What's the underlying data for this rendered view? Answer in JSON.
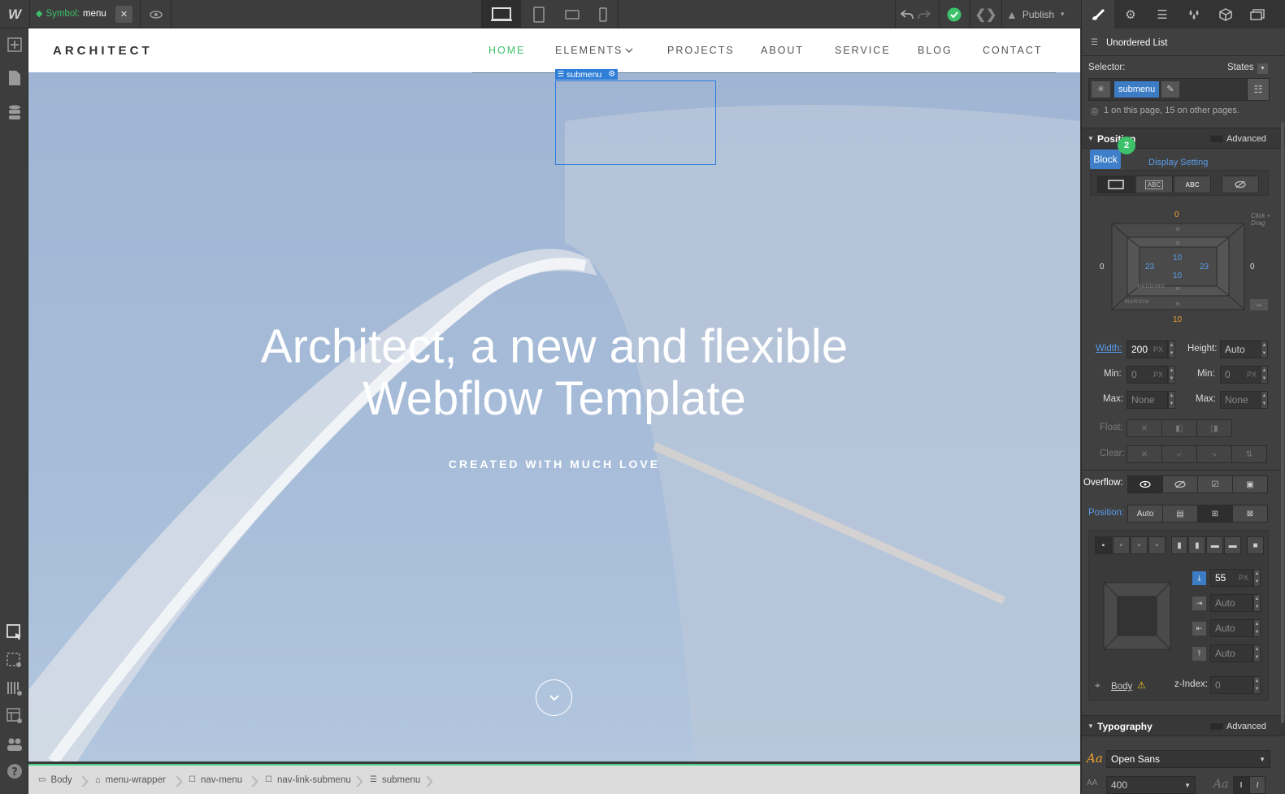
{
  "topbar": {
    "logo": "W",
    "symbol_prefix": "Symbol:",
    "symbol_name": "menu",
    "close_glyph": "✕",
    "publish_label": "Publish"
  },
  "canvas": {
    "brand": "ARCHITECT",
    "nav": [
      "HOME",
      "ELEMENTS",
      "PROJECTS",
      "ABOUT",
      "SERVICE",
      "BLOG",
      "CONTACT"
    ],
    "active_nav": "HOME",
    "selection_label": "submenu",
    "hero_title_line1": "Architect, a new and flexible",
    "hero_title_line2": "Webflow Template",
    "hero_subtitle": "CREATED WITH MUCH LOVE"
  },
  "breadcrumbs": [
    "Body",
    "menu-wrapper",
    "nav-menu",
    "nav-link-submenu",
    "submenu"
  ],
  "panel": {
    "element_type": "Unordered List",
    "selector_label": "Selector:",
    "states_label": "States",
    "selector_class": "submenu",
    "usage_note": "1 on this page, 15 on other pages.",
    "position_section": "Position",
    "advanced_label": "Advanced",
    "tooltip_block": "Block",
    "badge_count": "2",
    "display_setting": "Display Setting",
    "display_abc1": "ABC",
    "display_abc2": "ABC",
    "box": {
      "margin_top": "0",
      "margin_left": "0",
      "margin_right": "0",
      "margin_bottom": "10",
      "padding_top": "10",
      "padding_left": "23",
      "padding_right": "23",
      "padding_bottom": "10",
      "padding_label": "PADDING",
      "margin_label": "MARGIN",
      "click_drag": "Click + Drag"
    },
    "width_label": "Width:",
    "width_value": "200",
    "width_unit": "PX",
    "height_label": "Height:",
    "height_value": "Auto",
    "min_label": "Min:",
    "min_w_value": "0",
    "min_h_value": "0",
    "max_label": "Max:",
    "max_w_value": "None",
    "max_h_value": "None",
    "float_label": "Float:",
    "clear_label": "Clear:",
    "overflow_label": "Overflow:",
    "position_label": "Position:",
    "position_auto": "Auto",
    "offset_top_value": "55",
    "offset_top_unit": "PX",
    "offset_right_value": "Auto",
    "offset_left_value": "Auto",
    "offset_bottom_value": "Auto",
    "relative_to": "Body",
    "zindex_label": "z-Index:",
    "zindex_value": "0",
    "typography_section": "Typography",
    "font_family": "Open Sans",
    "font_weight": "400"
  },
  "colors": {
    "accent_green": "#3dc26b",
    "selection_blue": "#2f7fd9",
    "panel_bg": "#404040"
  }
}
